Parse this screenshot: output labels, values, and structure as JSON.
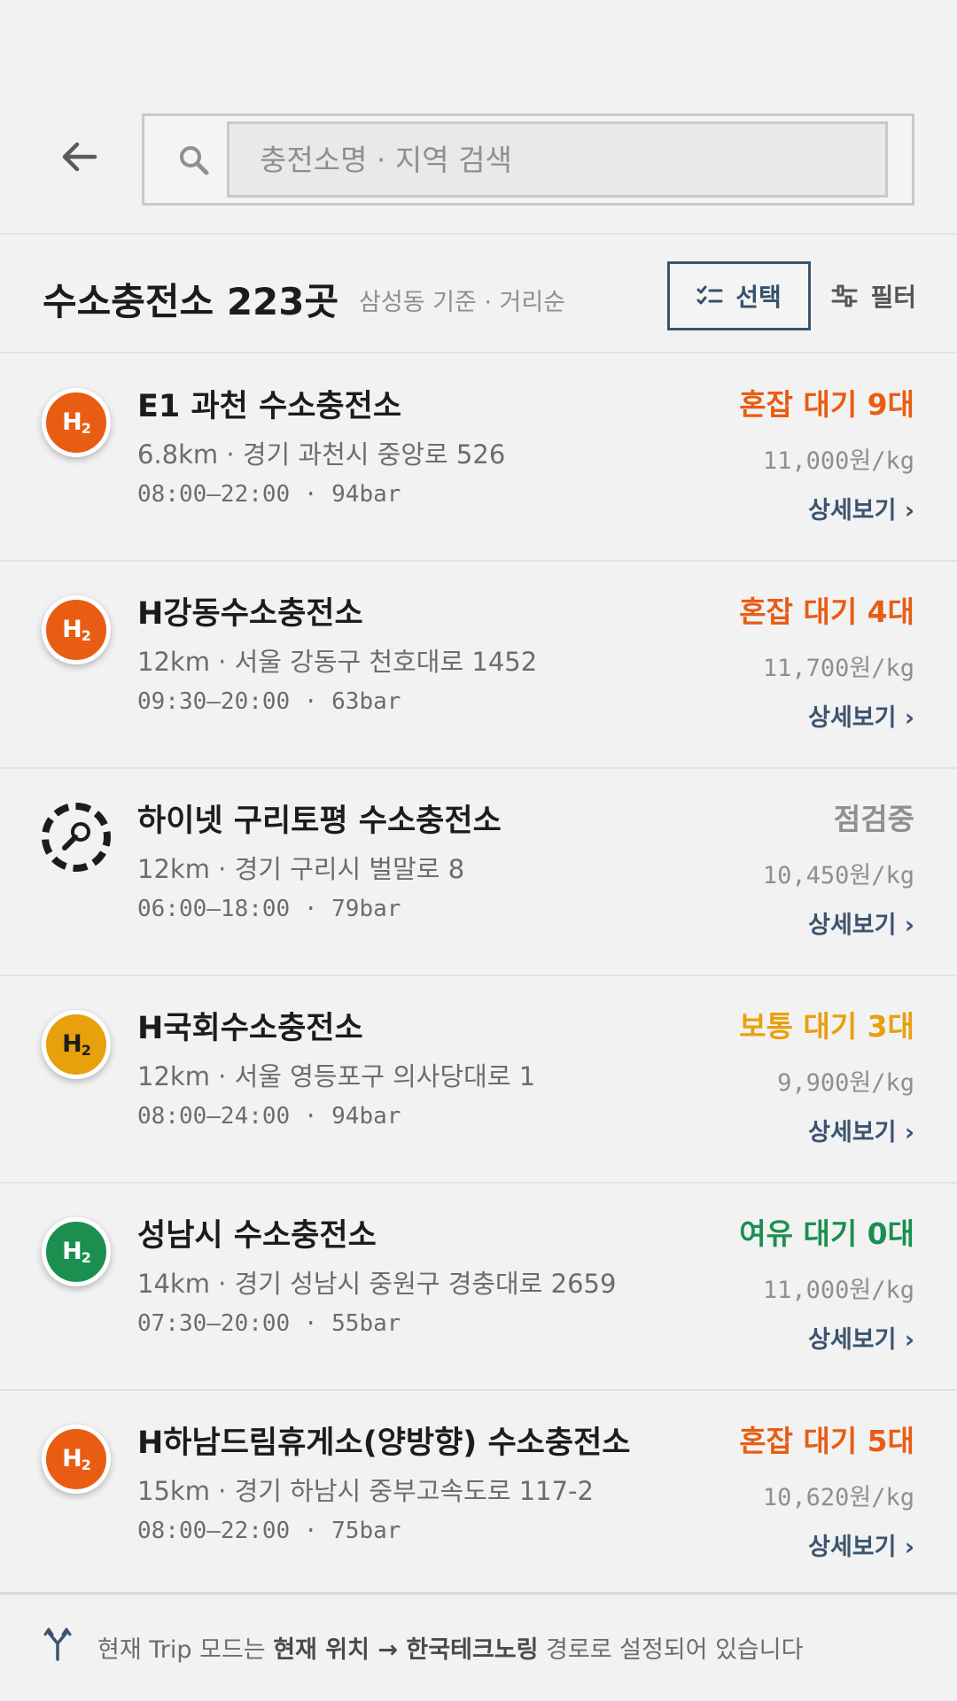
{
  "search": {
    "placeholder": "충전소명 · 지역 검색"
  },
  "summary": {
    "title": "수소충전소 223곳",
    "subtitle": "삼성동 기준 · 거리순",
    "select_label": "선택",
    "filter_label": "필터"
  },
  "colors": {
    "busy": "#e85d12",
    "normal": "#e8a00c",
    "free": "#1a8f4f",
    "maintenance": "#8e8e93",
    "accent": "#3b5470"
  },
  "stations": [
    {
      "name": "E1 과천 수소충전소",
      "address": "6.8km · 경기 과천시 중앙로 526",
      "hours": "08:00–22:00 · 94bar",
      "status": "혼잡 대기 9대",
      "status_level": "busy",
      "price": "11,000원/kg",
      "detail": "상세보기 ›",
      "icon": "h2-icon"
    },
    {
      "name": "H강동수소충전소",
      "address": "12km · 서울 강동구 천호대로 1452",
      "hours": "09:30–20:00 · 63bar",
      "status": "혼잡 대기 4대",
      "status_level": "busy",
      "price": "11,700원/kg",
      "detail": "상세보기 ›",
      "icon": "h2-icon"
    },
    {
      "name": "하이넷 구리토평 수소충전소",
      "address": "12km · 경기 구리시 벌말로 8",
      "hours": "06:00–18:00 · 79bar",
      "status": "점검중",
      "status_level": "maintenance",
      "price": "10,450원/kg",
      "detail": "상세보기 ›",
      "icon": "wrench-icon"
    },
    {
      "name": "H국회수소충전소",
      "address": "12km · 서울 영등포구 의사당대로 1",
      "hours": "08:00–24:00 · 94bar",
      "status": "보통 대기 3대",
      "status_level": "normal",
      "price": "9,900원/kg",
      "detail": "상세보기 ›",
      "icon": "h2-icon"
    },
    {
      "name": "성남시 수소충전소",
      "address": "14km · 경기 성남시 중원구 경충대로 2659",
      "hours": "07:30–20:00 · 55bar",
      "status": "여유 대기 0대",
      "status_level": "free",
      "price": "11,000원/kg",
      "detail": "상세보기 ›",
      "icon": "h2-icon"
    },
    {
      "name": "H하남드림휴게소(양방향) 수소충전소",
      "address": "15km · 경기 하남시 중부고속도로 117-2",
      "hours": "08:00–22:00 · 75bar",
      "status": "혼잡 대기 5대",
      "status_level": "busy",
      "price": "10,620원/kg",
      "detail": "상세보기 ›",
      "icon": "h2-icon"
    }
  ],
  "footer": {
    "prefix": "현재 Trip 모드는 ",
    "origin": "현재 위치",
    "arrow": " → ",
    "destination": "한국테크노링",
    "suffix": " 경로로 설정되어 있습니다"
  }
}
